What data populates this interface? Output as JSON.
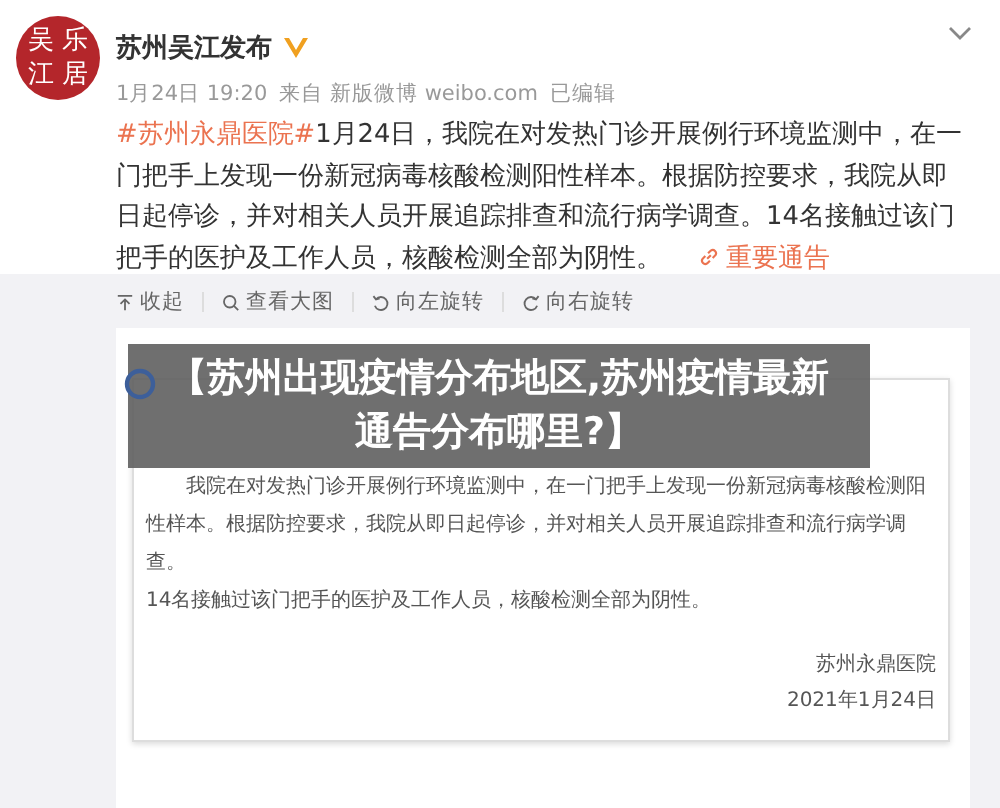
{
  "account": {
    "avatar_chars": [
      "吴",
      "乐",
      "江",
      "居"
    ],
    "name": "苏州吴江发布",
    "verified": true
  },
  "meta": {
    "time": "1月24日 19:20",
    "source": "来自 新版微博 weibo.com",
    "edited": "已编辑"
  },
  "post": {
    "hashtag": "#苏州永鼎医院#",
    "text": "1月24日，我院在对发热门诊开展例行环境监测中，在一门把手上发现一份新冠病毒核酸检测阳性样本。根据防控要求，我院从即日起停诊，并对相关人员开展追踪排查和流行病学调查。14名接触过该门把手的医护及工作人员，核酸检测全部为阴性。",
    "link": "重要通告"
  },
  "toolbar": [
    {
      "label": "收起",
      "kind": "collapse"
    },
    {
      "label": "查看大图",
      "kind": "zoom"
    },
    {
      "label": "向左旋转",
      "kind": "rotate-left"
    },
    {
      "label": "向右旋转",
      "kind": "rotate-right"
    }
  ],
  "overlay": {
    "title": "【苏州出现疫情分布地区,苏州疫情最新通告分布哪里?】"
  },
  "document": {
    "paragraphs": [
      "我院在对发热门诊开展例行环境监测中，在一门把手上发现一份新冠病毒核酸检测阳性样本。根据防控要求，我院从即日起停诊，并对相关人员开展追踪排查和流行病学调查。",
      "14名接触过该门把手的医护及工作人员，核酸检测全部为阴性。"
    ],
    "signature": "苏州永鼎医院",
    "date": "2021年1月24日"
  }
}
